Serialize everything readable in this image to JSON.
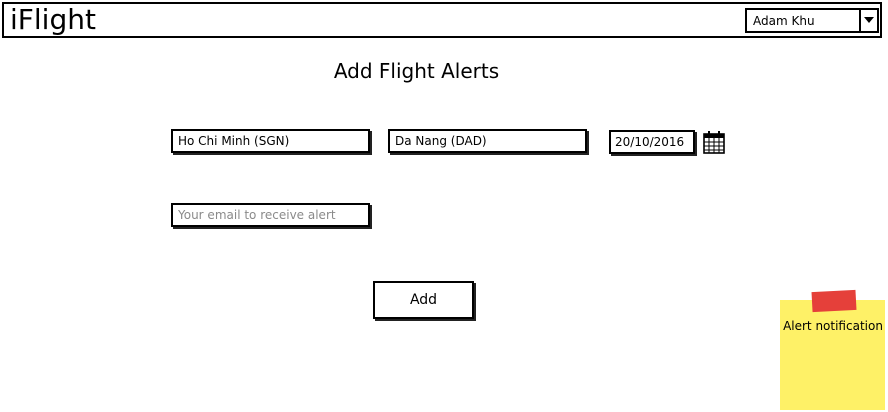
{
  "app": {
    "title": "iFlight"
  },
  "user_menu": {
    "selected": "Adam Khu"
  },
  "main": {
    "title": "Add Flight Alerts",
    "from": {
      "value": "Ho Chi Minh (SGN)"
    },
    "to": {
      "value": "Da Nang (DAD)"
    },
    "date": {
      "value": "20/10/2016"
    },
    "email": {
      "placeholder": "Your email to receive alert",
      "value": ""
    },
    "add_label": "Add"
  },
  "sticky_note": {
    "text": "Alert notification"
  },
  "icons": {
    "calendar": "calendar-icon",
    "dropdown": "chevron-down-icon"
  },
  "colors": {
    "sticky_note": "#fef167",
    "tape": "#e5403a"
  }
}
